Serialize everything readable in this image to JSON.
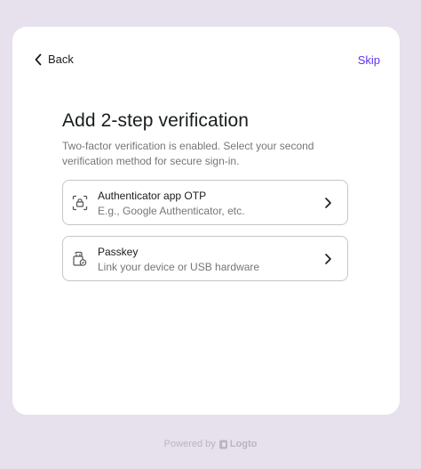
{
  "nav": {
    "back_label": "Back",
    "skip_label": "Skip"
  },
  "page": {
    "title": "Add 2-step verification",
    "description": "Two-factor verification is enabled. Select your second verification method for secure sign-in."
  },
  "options": [
    {
      "title": "Authenticator app OTP",
      "subtitle": "E.g., Google Authenticator, etc.",
      "icon": "authenticator-app-icon"
    },
    {
      "title": "Passkey",
      "subtitle": "Link your device or USB hardware",
      "icon": "passkey-icon"
    }
  ],
  "footer": {
    "powered_by": "Powered by",
    "brand": "Logto"
  },
  "colors": {
    "page_background": "#e6e1ec",
    "card_background": "#ffffff",
    "accent": "#5d34f2",
    "border": "#c4c7c7",
    "secondary_text": "#747778"
  }
}
